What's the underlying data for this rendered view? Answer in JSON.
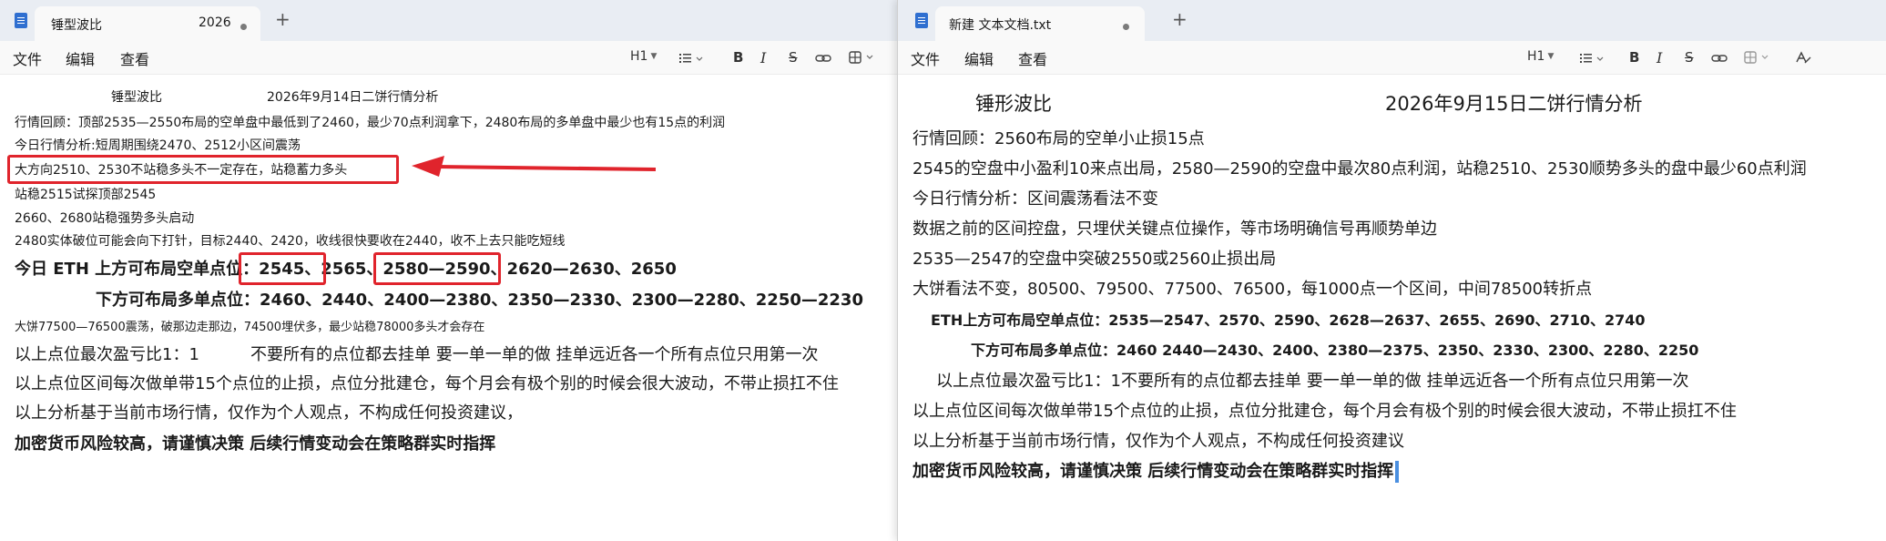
{
  "left": {
    "tab_title": "锤型波比",
    "tab_year": "2026",
    "menu": [
      "文件",
      "编辑",
      "查看"
    ],
    "toolbar": {
      "heading": "H1",
      "bold": "B",
      "italic": "I",
      "strike": "S"
    },
    "lines": [
      "锤型波比",
      "2026年9月14日二饼行情分析",
      "行情回顾：顶部2535—2550布局的空单盘中最低到了2460，最少70点利润拿下，2480布局的多单盘中最少也有15点的利润",
      "今日行情分析:短周期围绕2470、2512小区间震荡",
      "大方向2510、2530不站稳多头不一定存在，站稳蓄力多头",
      "站稳2515试探顶部2545",
      "2660、2680站稳强势多头启动",
      "2480实体破位可能会向下打针，目标2440、2420，收线很快要收在2440，收不上去只能吃短线",
      "今日 ETH 上方可布局空单点位：2545、2565、2580—2590、2620—2630、2650",
      "下方可布局多单点位：2460、2440、2400—2380、2350—2330、2300—2280、2250—2230",
      "大饼77500—76500震荡，破那边走那边，74500埋伏多，最少站稳78000多头才会存在",
      "以上点位最次盈亏比1：1",
      "不要所有的点位都去挂单  要一单一单的做 挂单远近各一个所有点位只用第一次",
      "以上点位区间每次做单带15个点位的止损，点位分批建仓，每个月会有极个别的时候会很大波动，不带止损扛不住",
      "以上分析基于当前市场行情，仅作为个人观点，不构成任何投资建议，",
      "加密货币风险较高，请谨慎决策 后续行情变动会在策略群实时指挥"
    ]
  },
  "right": {
    "tab_title": "新建 文本文档.txt",
    "menu": [
      "文件",
      "编辑",
      "查看"
    ],
    "toolbar": {
      "heading": "H1",
      "bold": "B",
      "italic": "I",
      "strike": "S"
    },
    "lines": [
      "锤形波比",
      "2026年9月15日二饼行情分析",
      "行情回顾：2560布局的空单小止损15点",
      "2545的空盘中小盈利10来点出局，2580—2590的空盘中最次80点利润，站稳2510、2530顺势多头的盘中最少60点利润",
      "今日行情分析：区间震荡看法不变",
      "数据之前的区间控盘，只埋伏关键点位操作，等市场明确信号再顺势单边",
      "2535—2547的空盘中突破2550或2560止损出局",
      "大饼看法不变，80500、79500、77500、76500，每1000点一个区间，中间78500转折点",
      "ETH上方可布局空单点位：2535—2547、2570、2590、2628—2637、2655、2690、2710、2740",
      "下方可布局多单点位：2460 2440—2430、2400、2380—2375、2350、2330、2300、2280、2250",
      "以上点位最次盈亏比1：1",
      "不要所有的点位都去挂单  要一单一单的做 挂单远近各一个所有点位只用第一次",
      "以上点位区间每次做单带15个点位的止损，点位分批建仓，每个月会有极个别的时候会很大波动，不带止损扛不住",
      "以上分析基于当前市场行情，仅作为个人观点，不构成任何投资建议",
      "加密货币风险较高，请谨慎决策 后续行情变动会在策略群实时指挥"
    ]
  },
  "colors": {
    "annotation": "#e0242c",
    "titlebar": "#e9edf3",
    "tab": "#f9f9f9",
    "cursor": "#4a8fe0"
  }
}
